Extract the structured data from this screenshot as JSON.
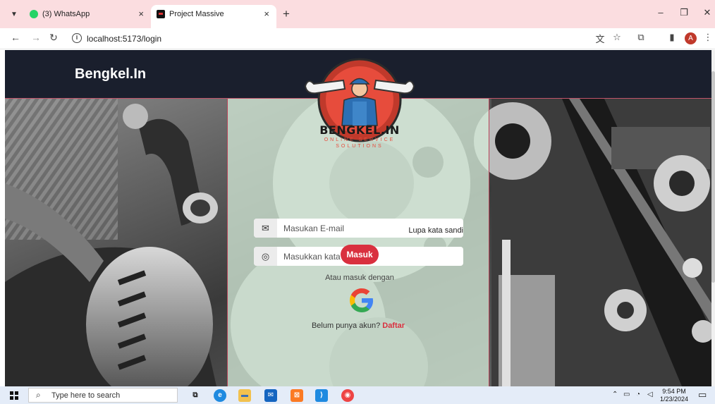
{
  "browser": {
    "tabs": [
      {
        "title": "(3) WhatsApp",
        "badge": "3",
        "active": false
      },
      {
        "title": "Project Massive",
        "active": true
      }
    ],
    "close_glyph": "×",
    "new_tab_glyph": "+",
    "url": "localhost:5173/login",
    "profile_initial": "A",
    "window_controls": {
      "minimize": "–",
      "restore": "❐",
      "close": "✕"
    }
  },
  "page": {
    "brand": "Bengkel.In",
    "logo": {
      "title": "BENGKEL.IN",
      "subtitle": "ONLINE SERVICE\nSOLUTIONS"
    },
    "form": {
      "email_placeholder": "Masukan E-mail",
      "password_placeholder": "Masukkan kata sandi",
      "forgot_label": "Lupa kata sandi",
      "login_label": "Masuk",
      "or_text": "Atau masuk dengan",
      "signup_prompt": "Belum punya akun?",
      "signup_link": "Daftar"
    }
  },
  "taskbar": {
    "search_placeholder": "Type here to search",
    "time": "9:54 PM",
    "date": "1/23/2024"
  },
  "icons": [
    "tab-list-icon",
    "whatsapp-icon",
    "project-favicon",
    "back-icon",
    "forward-icon",
    "reload-icon",
    "info-icon",
    "translate-icon",
    "star-icon",
    "extensions-icon",
    "sidepanel-icon",
    "profile-avatar",
    "menu-icon",
    "email-icon",
    "eye-slash-icon",
    "google-icon",
    "windows-start-icon",
    "search-icon",
    "task-view-icon",
    "edge-icon",
    "file-explorer-icon",
    "mail-icon",
    "xampp-icon",
    "vscode-icon",
    "chrome-icon",
    "notification-icon"
  ],
  "colors": {
    "navbar": "#1a1f2d",
    "accent": "#d9303f",
    "panel": "#d2e8d6",
    "tabstrip": "#fbdde0",
    "taskbar": "#e4ecf8"
  }
}
